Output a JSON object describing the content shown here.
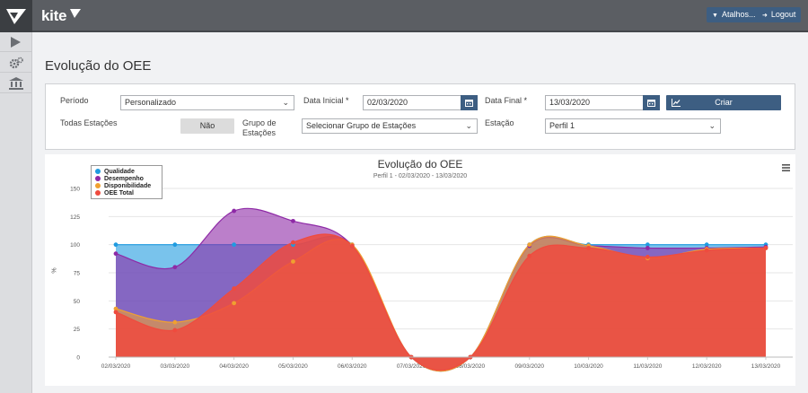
{
  "header": {
    "brand": "kite",
    "brand_sub": "",
    "shortcuts_label": "Atalhos...",
    "logout_label": "Logout"
  },
  "sidebar": {
    "items": [
      {
        "icon": "play-icon"
      },
      {
        "icon": "gears-icon"
      },
      {
        "icon": "bank-icon"
      }
    ]
  },
  "page": {
    "title": "Evolução do OEE"
  },
  "filters": {
    "period_label": "Período",
    "period_value": "Personalizado",
    "start_label": "Data Inicial",
    "start_value": "02/03/2020",
    "end_label": "Data Final",
    "end_value": "13/03/2020",
    "required_mark": "*",
    "create_label": "Criar",
    "all_stations_label": "Todas Estações",
    "all_stations_value": "Não",
    "group_label_1": "Grupo de",
    "group_label_2": "Estações",
    "group_value": "Selecionar Grupo de Estações",
    "station_label": "Estação",
    "station_value": "Perfil 1"
  },
  "colors": {
    "accent": "#3d5e82",
    "qualidade": "#1f9be0",
    "desempenho": "#8e2aa6",
    "disponibilidade": "#f0a030",
    "oee": "#ef4b3e"
  },
  "chart_data": {
    "type": "area",
    "title": "Evolução do OEE",
    "subtitle": "Perfil 1 - 02/03/2020 - 13/03/2020",
    "ylabel": "%",
    "xlabel": "",
    "ylim": [
      0,
      150
    ],
    "yticks": [
      0,
      25,
      50,
      75,
      100,
      125,
      150
    ],
    "grid": true,
    "legend_position": "top-left",
    "categories": [
      "02/03/2020",
      "03/03/2020",
      "04/03/2020",
      "05/03/2020",
      "06/03/2020",
      "07/03/2020",
      "08/03/2020",
      "09/03/2020",
      "10/03/2020",
      "11/03/2020",
      "12/03/2020",
      "13/03/2020"
    ],
    "series": [
      {
        "name": "Qualidade",
        "color": "#1f9be0",
        "values": [
          100,
          100,
          100,
          100,
          100,
          0,
          0,
          100,
          100,
          100,
          100,
          100
        ]
      },
      {
        "name": "Desempenho",
        "color": "#8e2aa6",
        "values": [
          92,
          80,
          130,
          121,
          99,
          0,
          0,
          99,
          99,
          97,
          97,
          98
        ]
      },
      {
        "name": "Disponibilidade",
        "color": "#f0a030",
        "values": [
          43,
          31,
          48,
          85,
          100,
          0,
          0,
          100,
          99,
          88,
          96,
          97
        ]
      },
      {
        "name": "OEE Total",
        "color": "#ef4b3e",
        "values": [
          40,
          24,
          61,
          102,
          99,
          0,
          0,
          90,
          97,
          89,
          95,
          97
        ]
      }
    ]
  }
}
